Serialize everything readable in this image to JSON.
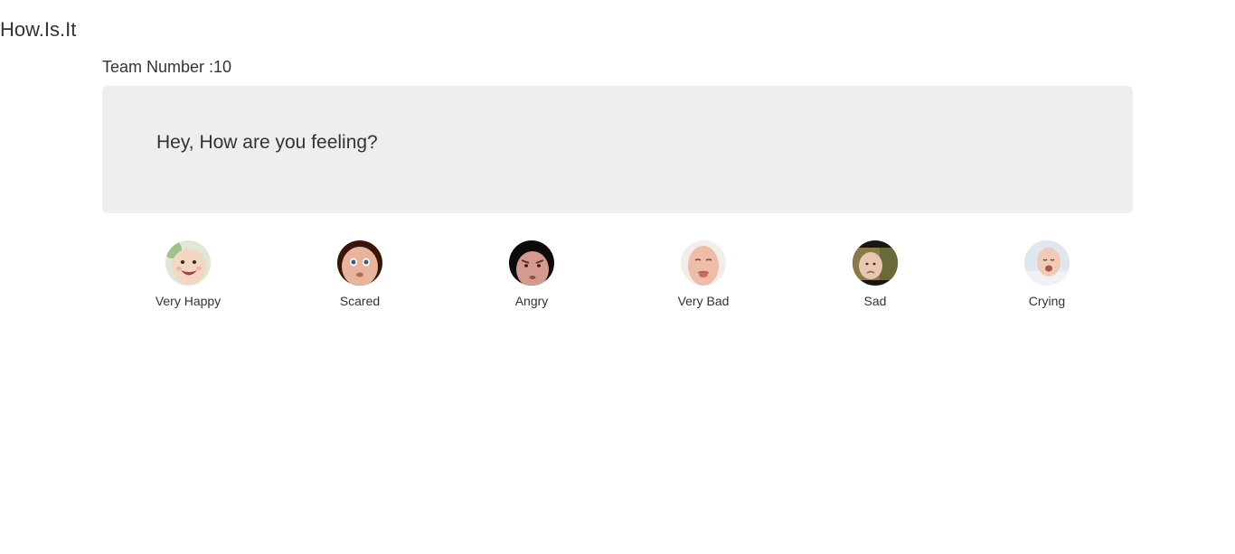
{
  "header": {
    "brand": "How.Is.It"
  },
  "main": {
    "team_number_label": "Team Number :10",
    "question": "Hey, How are you feeling?",
    "moods": [
      {
        "label": "Very Happy",
        "icon": "very-happy-baby-photo"
      },
      {
        "label": "Scared",
        "icon": "scared-baby-photo"
      },
      {
        "label": "Angry",
        "icon": "angry-baby-photo"
      },
      {
        "label": "Very Bad",
        "icon": "very-bad-baby-photo"
      },
      {
        "label": "Sad",
        "icon": "sad-baby-photo"
      },
      {
        "label": "Crying",
        "icon": "crying-baby-photo"
      }
    ]
  },
  "colors": {
    "jumbotron_bg": "#eeeeee",
    "text": "#333333",
    "background": "#ffffff"
  }
}
